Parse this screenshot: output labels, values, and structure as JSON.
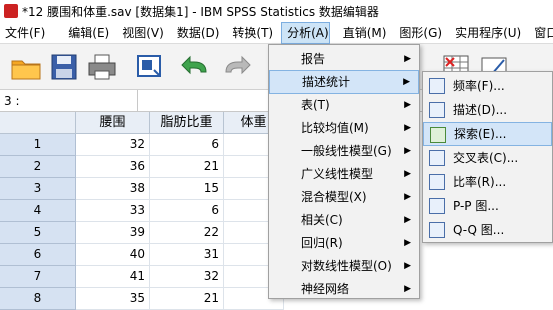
{
  "window": {
    "title": "*12 腰围和体重.sav [数据集1] - IBM SPSS Statistics 数据编辑器"
  },
  "menubar": [
    {
      "label": "文件(F)"
    },
    {
      "label": "编辑(E)"
    },
    {
      "label": "视图(V)"
    },
    {
      "label": "数据(D)"
    },
    {
      "label": "转换(T)"
    },
    {
      "label": "分析(A)"
    },
    {
      "label": "直销(M)"
    },
    {
      "label": "图形(G)"
    },
    {
      "label": "实用程序(U)"
    },
    {
      "label": "窗口(W)"
    }
  ],
  "cellbar": {
    "ref": "3 :"
  },
  "grid": {
    "columns": [
      "腰围",
      "脂肪比重",
      "体重"
    ],
    "rows": [
      {
        "n": "1",
        "v": [
          "32",
          "6",
          ""
        ]
      },
      {
        "n": "2",
        "v": [
          "36",
          "21",
          ""
        ]
      },
      {
        "n": "3",
        "v": [
          "38",
          "15",
          ""
        ]
      },
      {
        "n": "4",
        "v": [
          "33",
          "6",
          ""
        ]
      },
      {
        "n": "5",
        "v": [
          "39",
          "22",
          ""
        ]
      },
      {
        "n": "6",
        "v": [
          "40",
          "31",
          ""
        ]
      },
      {
        "n": "7",
        "v": [
          "41",
          "32",
          ""
        ]
      },
      {
        "n": "8",
        "v": [
          "35",
          "21",
          ""
        ]
      }
    ]
  },
  "analyze_menu": [
    {
      "label": "报告"
    },
    {
      "label": "描述统计"
    },
    {
      "label": "表(T)"
    },
    {
      "label": "比较均值(M)"
    },
    {
      "label": "一般线性模型(G)"
    },
    {
      "label": "广义线性模型"
    },
    {
      "label": "混合模型(X)"
    },
    {
      "label": "相关(C)"
    },
    {
      "label": "回归(R)"
    },
    {
      "label": "对数线性模型(O)"
    },
    {
      "label": "神经网络"
    }
  ],
  "descriptive_menu": [
    {
      "label": "频率(F)...",
      "icon": "frequencies-icon"
    },
    {
      "label": "描述(D)...",
      "icon": "descriptives-icon"
    },
    {
      "label": "探索(E)...",
      "icon": "explore-icon"
    },
    {
      "label": "交叉表(C)...",
      "icon": "crosstabs-icon"
    },
    {
      "label": "比率(R)...",
      "icon": "ratio-icon"
    },
    {
      "label": "P-P 图...",
      "icon": "pp-plot-icon"
    },
    {
      "label": "Q-Q 图...",
      "icon": "qq-plot-icon"
    }
  ]
}
